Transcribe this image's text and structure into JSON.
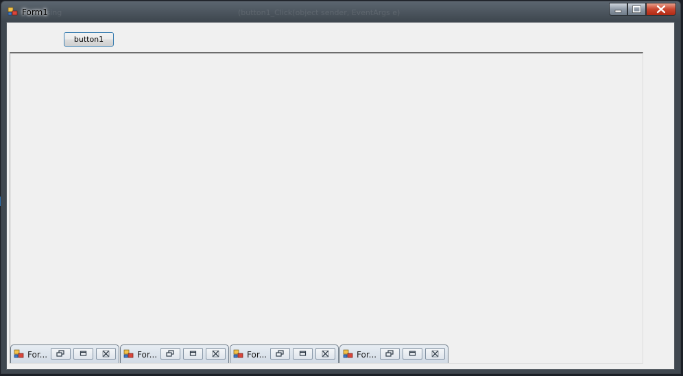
{
  "window": {
    "title": "Form1",
    "ghost_texts": [
      "...sing",
      "(button1_Click(object sender, EventArgs e)"
    ]
  },
  "form": {
    "button1_label": "button1"
  },
  "mdi_minimized_children": [
    {
      "title": "For..."
    },
    {
      "title": "For..."
    },
    {
      "title": "For..."
    },
    {
      "title": "For..."
    }
  ],
  "colors": {
    "client_bg": "#f0f0f0",
    "button_border": "#3c7fb1",
    "close_button": "#c9452e"
  },
  "icons": [
    "form-icon",
    "restore-icon",
    "maximize-icon",
    "close-icon",
    "minimize-icon"
  ]
}
